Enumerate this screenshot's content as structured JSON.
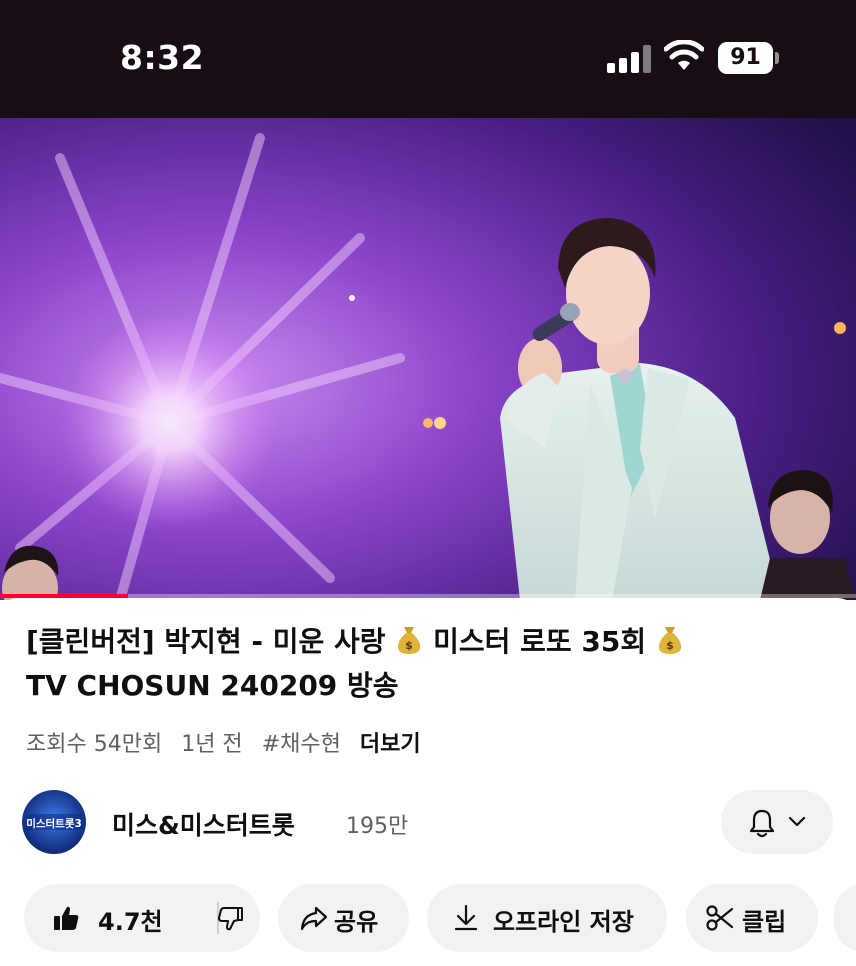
{
  "status_bar": {
    "time": "8:32",
    "battery_level": "91",
    "cellular_bars": 4,
    "icons": [
      "signal-icon",
      "wifi-icon",
      "battery-icon"
    ]
  },
  "video": {
    "description_icons": [
      "stage-light",
      "singer"
    ],
    "progress_fraction": 0.15,
    "accent_color": "#ff0033"
  },
  "title": {
    "line1_part1": "[클린버전] 박지현 - 미운 사랑 ",
    "line1_part2": " 미스터 로또 35회",
    "line2": "TV CHOSUN 240209 방송",
    "emoji_icon": "money-bag-icon"
  },
  "meta": {
    "views": "조회수 54만회",
    "age": "1년 전",
    "hashtag": "#채수현",
    "more": "더보기"
  },
  "channel": {
    "avatar_text": "미스터트롯3",
    "name": "미스&미스터트롯",
    "subscribers": "195만"
  },
  "actions": {
    "like_count": "4.7천",
    "share": "공유",
    "download": "오프라인 저장",
    "clip": "클립"
  }
}
